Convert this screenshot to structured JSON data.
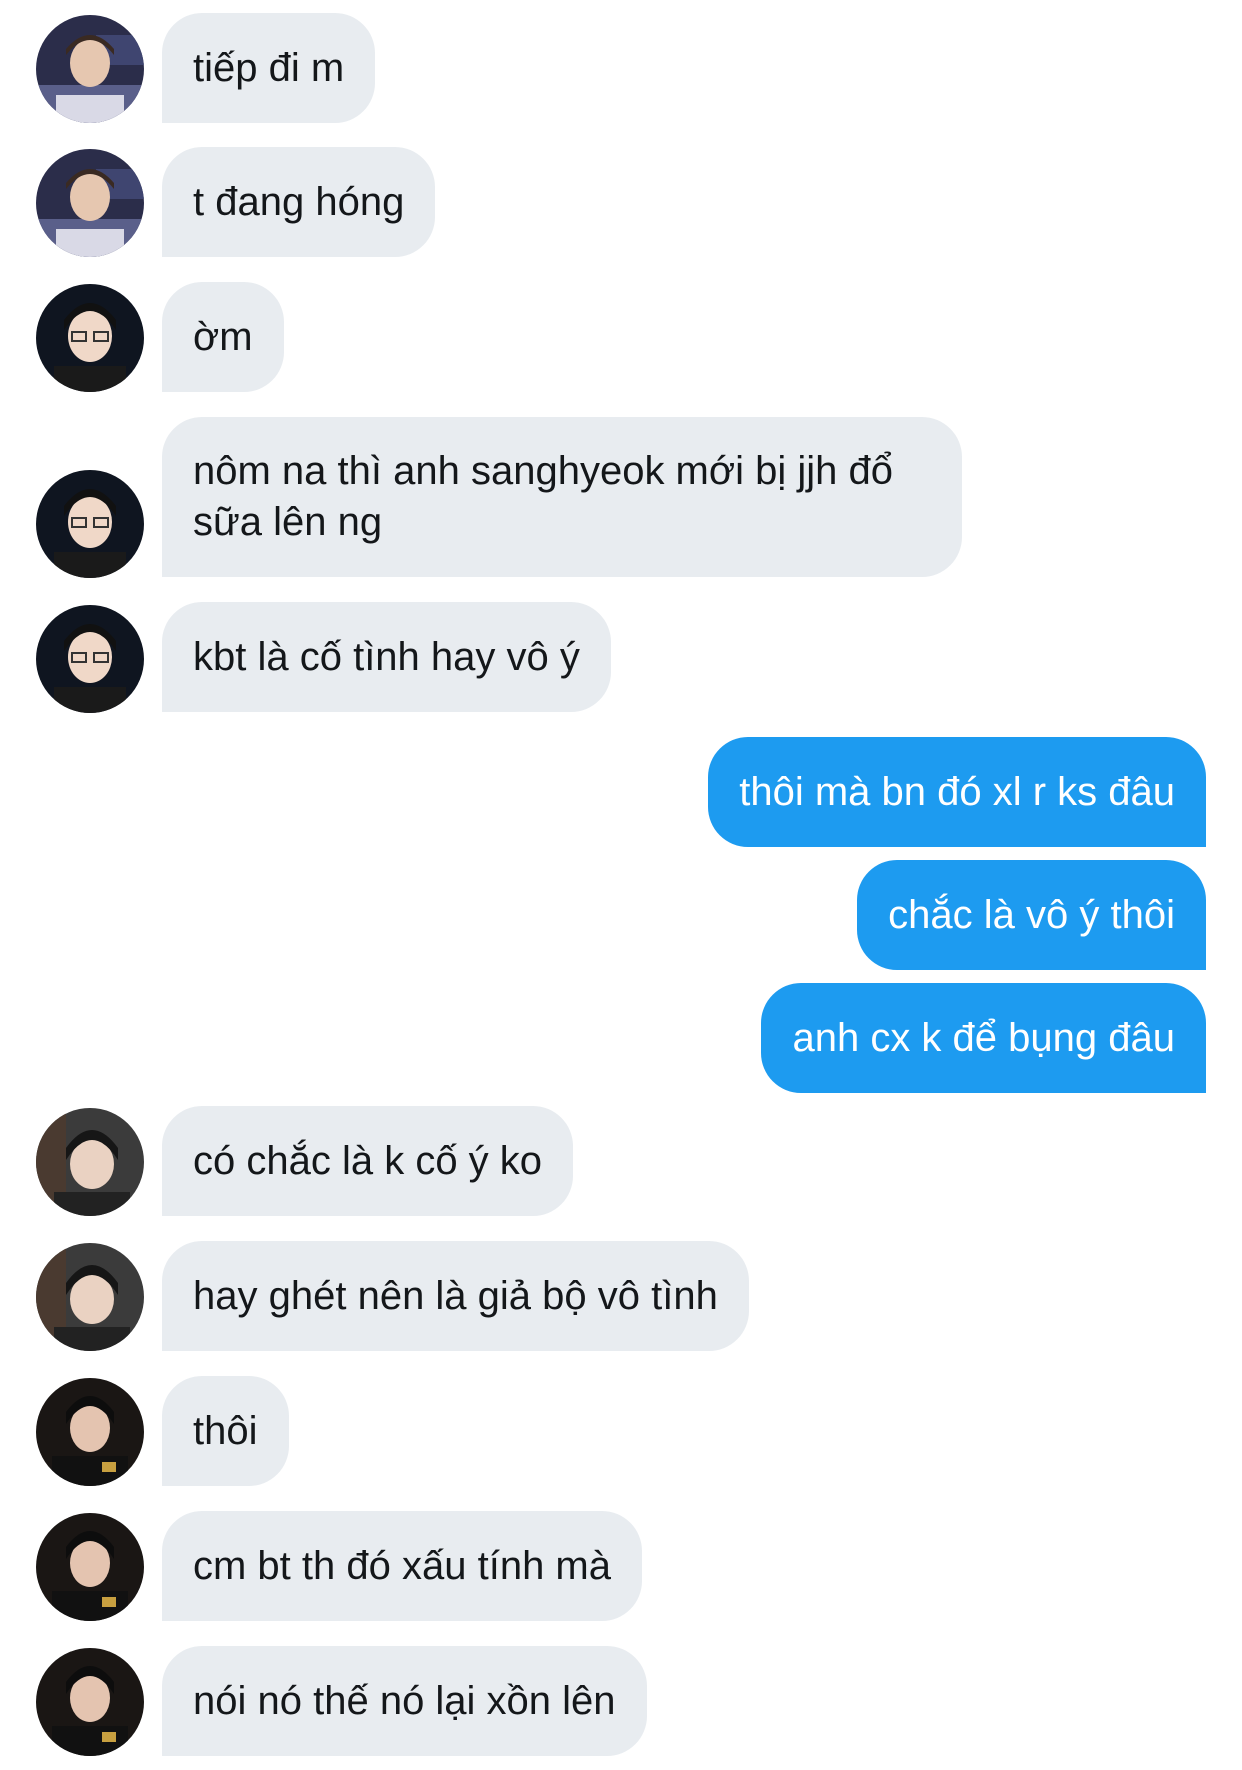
{
  "messages": [
    {
      "sender": "them",
      "avatar": "avatar-a",
      "text": "tiếp đi m"
    },
    {
      "sender": "them",
      "avatar": "avatar-a",
      "text": "t đang hóng"
    },
    {
      "sender": "them",
      "avatar": "avatar-b",
      "text": "ờm"
    },
    {
      "sender": "them",
      "avatar": "avatar-b",
      "text": "nôm na thì anh sanghyeok mới bị jjh đổ sữa lên ng"
    },
    {
      "sender": "them",
      "avatar": "avatar-b",
      "text": "kbt là cố tình hay vô ý"
    },
    {
      "sender": "me",
      "text": "thôi mà bn đó xl r ks đâu"
    },
    {
      "sender": "me",
      "text": "chắc là vô ý thôi"
    },
    {
      "sender": "me",
      "text": "anh cx k để bụng đâu"
    },
    {
      "sender": "them",
      "avatar": "avatar-c",
      "text": "có chắc là k cố ý ko"
    },
    {
      "sender": "them",
      "avatar": "avatar-c",
      "text": "hay ghét nên là giả bộ vô tình"
    },
    {
      "sender": "them",
      "avatar": "avatar-d",
      "text": "thôi"
    },
    {
      "sender": "them",
      "avatar": "avatar-d",
      "text": "cm bt th đó xấu tính mà"
    },
    {
      "sender": "them",
      "avatar": "avatar-d",
      "text": "nói nó thế nó lại xồn lên"
    }
  ],
  "colors": {
    "incoming_bubble": "#e8ecf0",
    "outgoing_bubble": "#1d9bf0",
    "incoming_text": "#14171a",
    "outgoing_text": "#ffffff"
  }
}
